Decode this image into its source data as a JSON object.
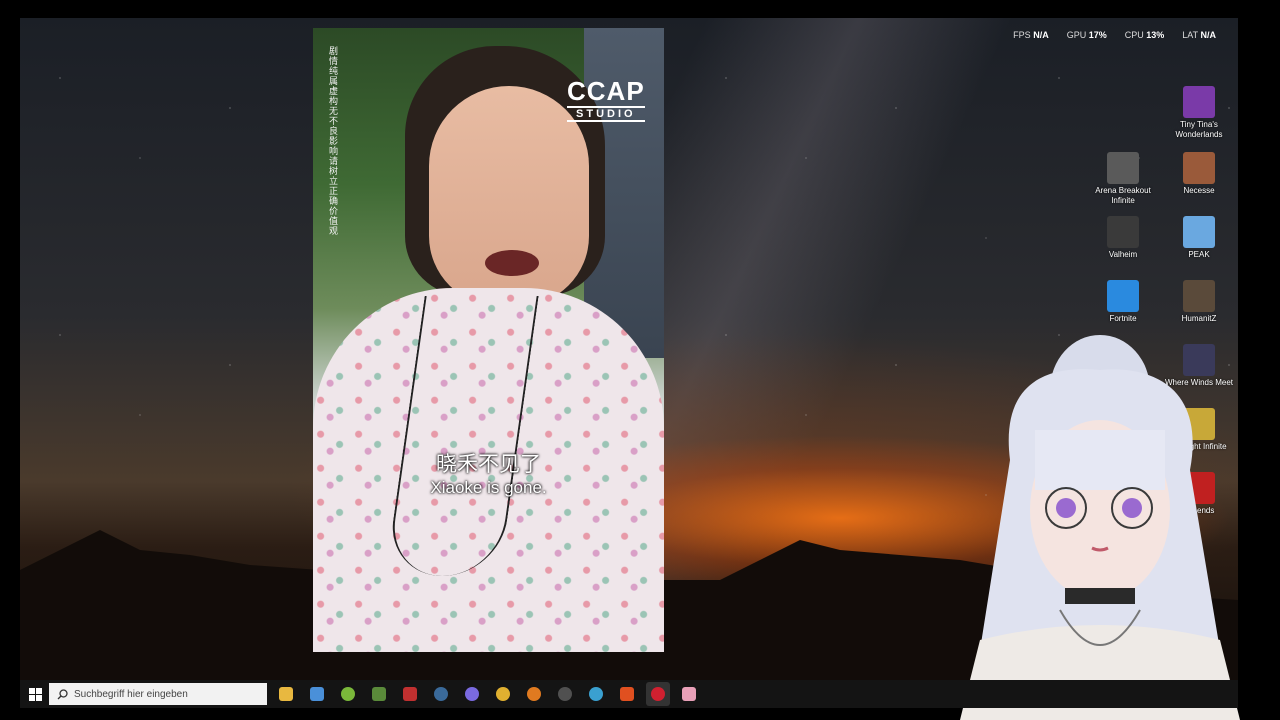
{
  "overlay_stats": [
    {
      "label": "FPS",
      "value": "N/A"
    },
    {
      "label": "GPU",
      "value": "17%"
    },
    {
      "label": "CPU",
      "value": "13%"
    },
    {
      "label": "LAT",
      "value": "N/A"
    }
  ],
  "video": {
    "side_text": "剧情纯属虚构 无不良影响 请树立正确价值观",
    "logo_top": "CCAP",
    "logo_bottom": "STUDIO",
    "subtitle_cn": "晓禾不见了",
    "subtitle_en": "Xiaoke is gone."
  },
  "desktop_icons": [
    {
      "label": "Tiny Tina's Wonderlands",
      "color": "#7a3aa8"
    },
    {
      "label": "Arena Breakout Infinite",
      "color": "#5a5a5a"
    },
    {
      "label": "Necesse",
      "color": "#9a5a3a"
    },
    {
      "label": "Valheim",
      "color": "#3a3a3a"
    },
    {
      "label": "PEAK",
      "color": "#6aa8e0"
    },
    {
      "label": "Fortnite",
      "color": "#2a8adf"
    },
    {
      "label": "HumanitZ",
      "color": "#5a4a3a"
    },
    {
      "label": "Where Winds Meet",
      "color": "#3a3a5a"
    },
    {
      "label": "Starlight Infinite",
      "color": "#c8a838"
    },
    {
      "label": "Legends",
      "color": "#c02020"
    }
  ],
  "taskbar": {
    "search_placeholder": "Suchbegriff hier eingeben",
    "apps": [
      {
        "name": "file-explorer",
        "color": "#e8b840"
      },
      {
        "name": "store",
        "color": "#4a90d9"
      },
      {
        "name": "app-green",
        "color": "#7ab83a"
      },
      {
        "name": "app-minecraft",
        "color": "#5a8a3a"
      },
      {
        "name": "app-red",
        "color": "#c03030"
      },
      {
        "name": "steam",
        "color": "#3a6a9a"
      },
      {
        "name": "discord",
        "color": "#7a6ae0"
      },
      {
        "name": "chrome",
        "color": "#e0b030"
      },
      {
        "name": "firefox",
        "color": "#e07a20"
      },
      {
        "name": "obs",
        "color": "#505050"
      },
      {
        "name": "app-blue",
        "color": "#3aa0d0"
      },
      {
        "name": "brave",
        "color": "#e05020"
      },
      {
        "name": "opera",
        "color": "#d02030"
      },
      {
        "name": "app-pink",
        "color": "#e8a0b8"
      }
    ]
  }
}
